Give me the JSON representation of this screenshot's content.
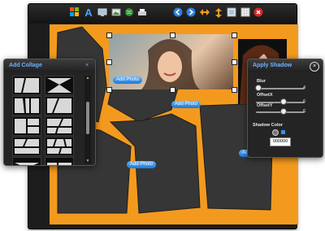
{
  "toolbar": {
    "buttons": [
      "windows-icon",
      "text-tool-icon",
      "screen-icon",
      "picture-icon",
      "globe-icon",
      "scanner-icon",
      "arrow-left-icon",
      "arrow-right-icon",
      "horizontal-flip-icon",
      "vertical-flip-icon",
      "frame-icon",
      "grid-icon",
      "delete-icon"
    ]
  },
  "canvas": {
    "add_photo_labels": [
      "Add Photo",
      "Add Photo",
      "Add Photo",
      "Add Photo"
    ]
  },
  "collage_panel": {
    "title": "Add Collage",
    "close_label": "×",
    "scroll_up": "▲",
    "scroll_down": "▼"
  },
  "shadow_panel": {
    "title": "Apply Shadow",
    "close_label": "×",
    "blur_label": "Blur",
    "blur_value": "4",
    "offsetx_label": "OffsetX",
    "offsetx_value": "6",
    "offsety_label": "OffsetY",
    "offsety_value": "6",
    "color_label": "Shadow Color",
    "color_value": "000000"
  },
  "colors": {
    "accent": "#f39a1e",
    "panel_title": "#6fb2ff",
    "button": "#2a86e0"
  }
}
